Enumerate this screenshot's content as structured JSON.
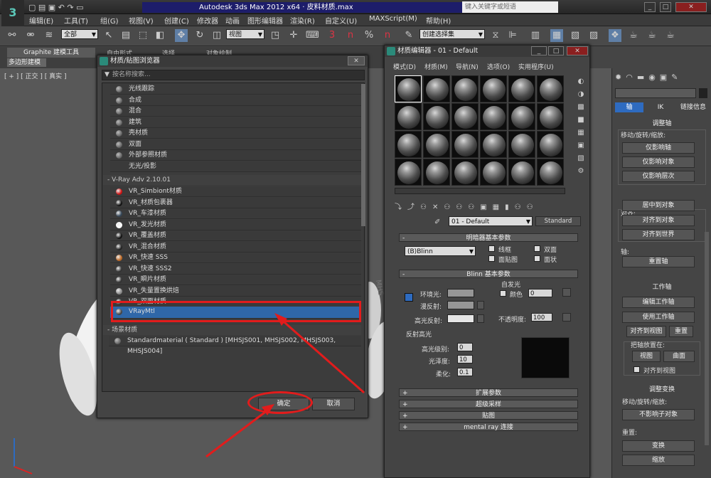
{
  "app": {
    "title": "Autodesk 3ds Max  2012 x64  ·  皮料材质.max",
    "search_placeholder": "键入关键字或短语",
    "logo": "3"
  },
  "menu": [
    "编辑(E)",
    "工具(T)",
    "组(G)",
    "视图(V)",
    "创建(C)",
    "修改器",
    "动画",
    "图形编辑器",
    "渲染(R)",
    "自定义(U)",
    "MAXScript(M)",
    "帮助(H)"
  ],
  "toolbar": {
    "selection_filter": "全部",
    "ref_coord": "视图",
    "named_sel": "创建选择集",
    "snap_labels": [
      "3",
      "n",
      "%",
      "n"
    ]
  },
  "ribbon": {
    "graphite_label": "Graphite 建模工具",
    "tabs": [
      "自由形式",
      "选择",
      "对象绘制"
    ],
    "polymod": "多边形建模"
  },
  "viewport": {
    "label": "[ + ] [ 正交 ] [ 真实 ]",
    "side_text": "MHS"
  },
  "browser": {
    "title": "材质/贴图浏览器",
    "search_placeholder": "按名称搜索...",
    "std_materials": [
      "光线跟踪",
      "合成",
      "混合",
      "建筑",
      "壳材质",
      "双面",
      "外部参照材质",
      "无光/投影"
    ],
    "vray_group": "- V-Ray Adv 2.10.01",
    "vray_materials": [
      "VR_Simbiont材质",
      "VR_材质包裹器",
      "VR_车漆材质",
      "VR_发光材质",
      "VR_覆盖材质",
      "VR_混合材质",
      "VR_快速 SSS",
      "VR_快速 SSS2",
      "VR_瞬片材质",
      "VR_失量置换烘焙",
      "VR_双面材质",
      "VRayMtl"
    ],
    "scene_group": "- 场景材质",
    "scene_item": "Standardmaterial  ( Standard )  [MHSJS001, MHSJS002, MHSJS003, MHSJS004]",
    "ok_label": "确定",
    "cancel_label": "取消"
  },
  "mated": {
    "title": "材质编辑器 - 01 - Default",
    "menu": [
      "模式(D)",
      "材质(M)",
      "导航(N)",
      "选项(O)",
      "实用程序(U)"
    ],
    "material_name": "01 - Default",
    "material_type": "Standard",
    "shader_rollout": "明暗器基本参数",
    "shader_type": "(B)Blinn",
    "wire": "线框",
    "twosided": "双面",
    "facemap": "面贴图",
    "faceted": "面状",
    "blinn_rollout": "Blinn 基本参数",
    "self_illum": "自发光",
    "color_label": "颜色",
    "color_value": "0",
    "ambient": "环境光:",
    "diffuse": "漫反射:",
    "specular": "高光反射:",
    "opacity_label": "不透明度:",
    "opacity_value": "100",
    "spec_group": "反射高光",
    "spec_level": "高光级别:",
    "spec_level_value": "0",
    "gloss": "光泽度:",
    "gloss_value": "10",
    "soften": "柔化:",
    "soften_value": "0.1",
    "rollouts": [
      "扩展参数",
      "超级采样",
      "贴图",
      "mental ray 连接"
    ],
    "ambient_color": "#969696",
    "diffuse_color": "#969696",
    "specular_color": "#e6e6e6"
  },
  "cmdpanel": {
    "tabs": [
      "轴",
      "IK",
      "链接信息"
    ],
    "adjust_pivot": "调整轴",
    "move_rotate_scale": "移动/旋转/缩放:",
    "affect_pivot_only": "仅影响轴",
    "affect_object_only": "仅影响对象",
    "affect_hierarchy_only": "仅影响层次",
    "align": "对齐:",
    "center_to_object": "居中到对象",
    "align_to_object": "对齐到对象",
    "align_to_world": "对齐到世界",
    "pivot": "轴:",
    "reset_pivot": "重置轴",
    "working_pivot": "工作轴",
    "edit_working_pivot": "编辑工作轴",
    "use_working_pivot": "使用工作轴",
    "align_to_view": "对齐到视图",
    "reset": "重置",
    "place_pivot": "把轴放置在:",
    "view": "视图",
    "surface": "曲面",
    "align_to_view_chk": "对齐到视图",
    "adjust_transform": "调整变换",
    "move_rot_scale2": "移动/旋转/缩放:",
    "dont_affect_children": "不影响子对象",
    "reset2": "重置:",
    "transform": "变换",
    "scale": "缩放"
  },
  "colors": {
    "annotation_red": "#e21c1c",
    "selected_row": "#2f67a8",
    "accent_blue": "#2e6bc0"
  }
}
